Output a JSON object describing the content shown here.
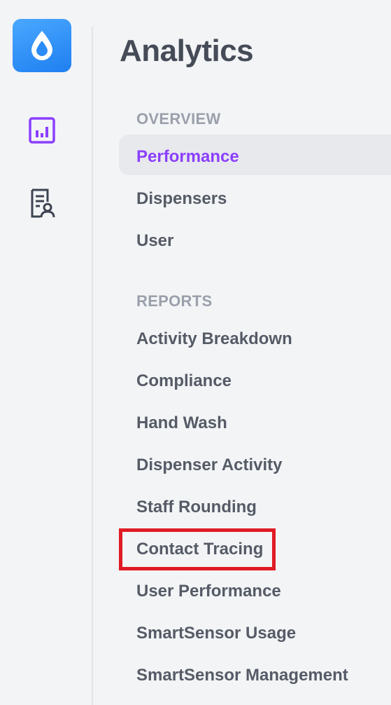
{
  "app": {
    "title": "Analytics"
  },
  "rail": {
    "items": [
      {
        "name": "analytics",
        "icon": "bar-chart-icon",
        "active": true
      },
      {
        "name": "reports",
        "icon": "report-user-icon",
        "active": false
      }
    ],
    "logo_icon": "water-drop-icon"
  },
  "menu": {
    "overview_label": "OVERVIEW",
    "overview_items": [
      {
        "label": "Performance",
        "active": true
      },
      {
        "label": "Dispensers"
      },
      {
        "label": "User"
      }
    ],
    "reports_label": "REPORTS",
    "reports_items": [
      {
        "label": "Activity Breakdown"
      },
      {
        "label": "Compliance"
      },
      {
        "label": "Hand Wash"
      },
      {
        "label": "Dispenser Activity"
      },
      {
        "label": "Staff Rounding"
      },
      {
        "label": "Contact Tracing",
        "highlighted": true
      },
      {
        "label": "User Performance"
      },
      {
        "label": "SmartSensor Usage"
      },
      {
        "label": "SmartSensor Management"
      }
    ]
  },
  "colors": {
    "accent": "#8b3fff",
    "brand_blue": "#2b8cf7",
    "highlight_red": "#e01b24",
    "text": "#555b66",
    "section": "#9aa0ab",
    "background": "#f3f4f6"
  }
}
